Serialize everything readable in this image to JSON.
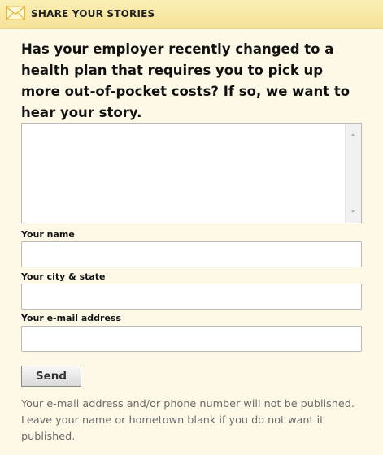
{
  "header": {
    "icon": "envelope-icon",
    "title": "SHARE YOUR STORIES"
  },
  "prompt": {
    "question": "Has your employer recently changed to a health plan that requires you to pick up more out-of-pocket costs? If so, we want to hear your story."
  },
  "story": {
    "value": ""
  },
  "fields": {
    "name_label": "Your name",
    "name_value": "",
    "city_label": "Your city & state",
    "city_value": "",
    "email_label": "Your e-mail address",
    "email_value": ""
  },
  "actions": {
    "send_label": "Send"
  },
  "disclaimer": "Your e-mail address and/or phone number will not be published. Leave your name or hometown blank if you do not want it published.",
  "colors": {
    "background": "#fdf9e6",
    "header_background": "#f6e196",
    "envelope_accent": "#e6b73a",
    "disclaimer_text": "#6b6b6b"
  }
}
